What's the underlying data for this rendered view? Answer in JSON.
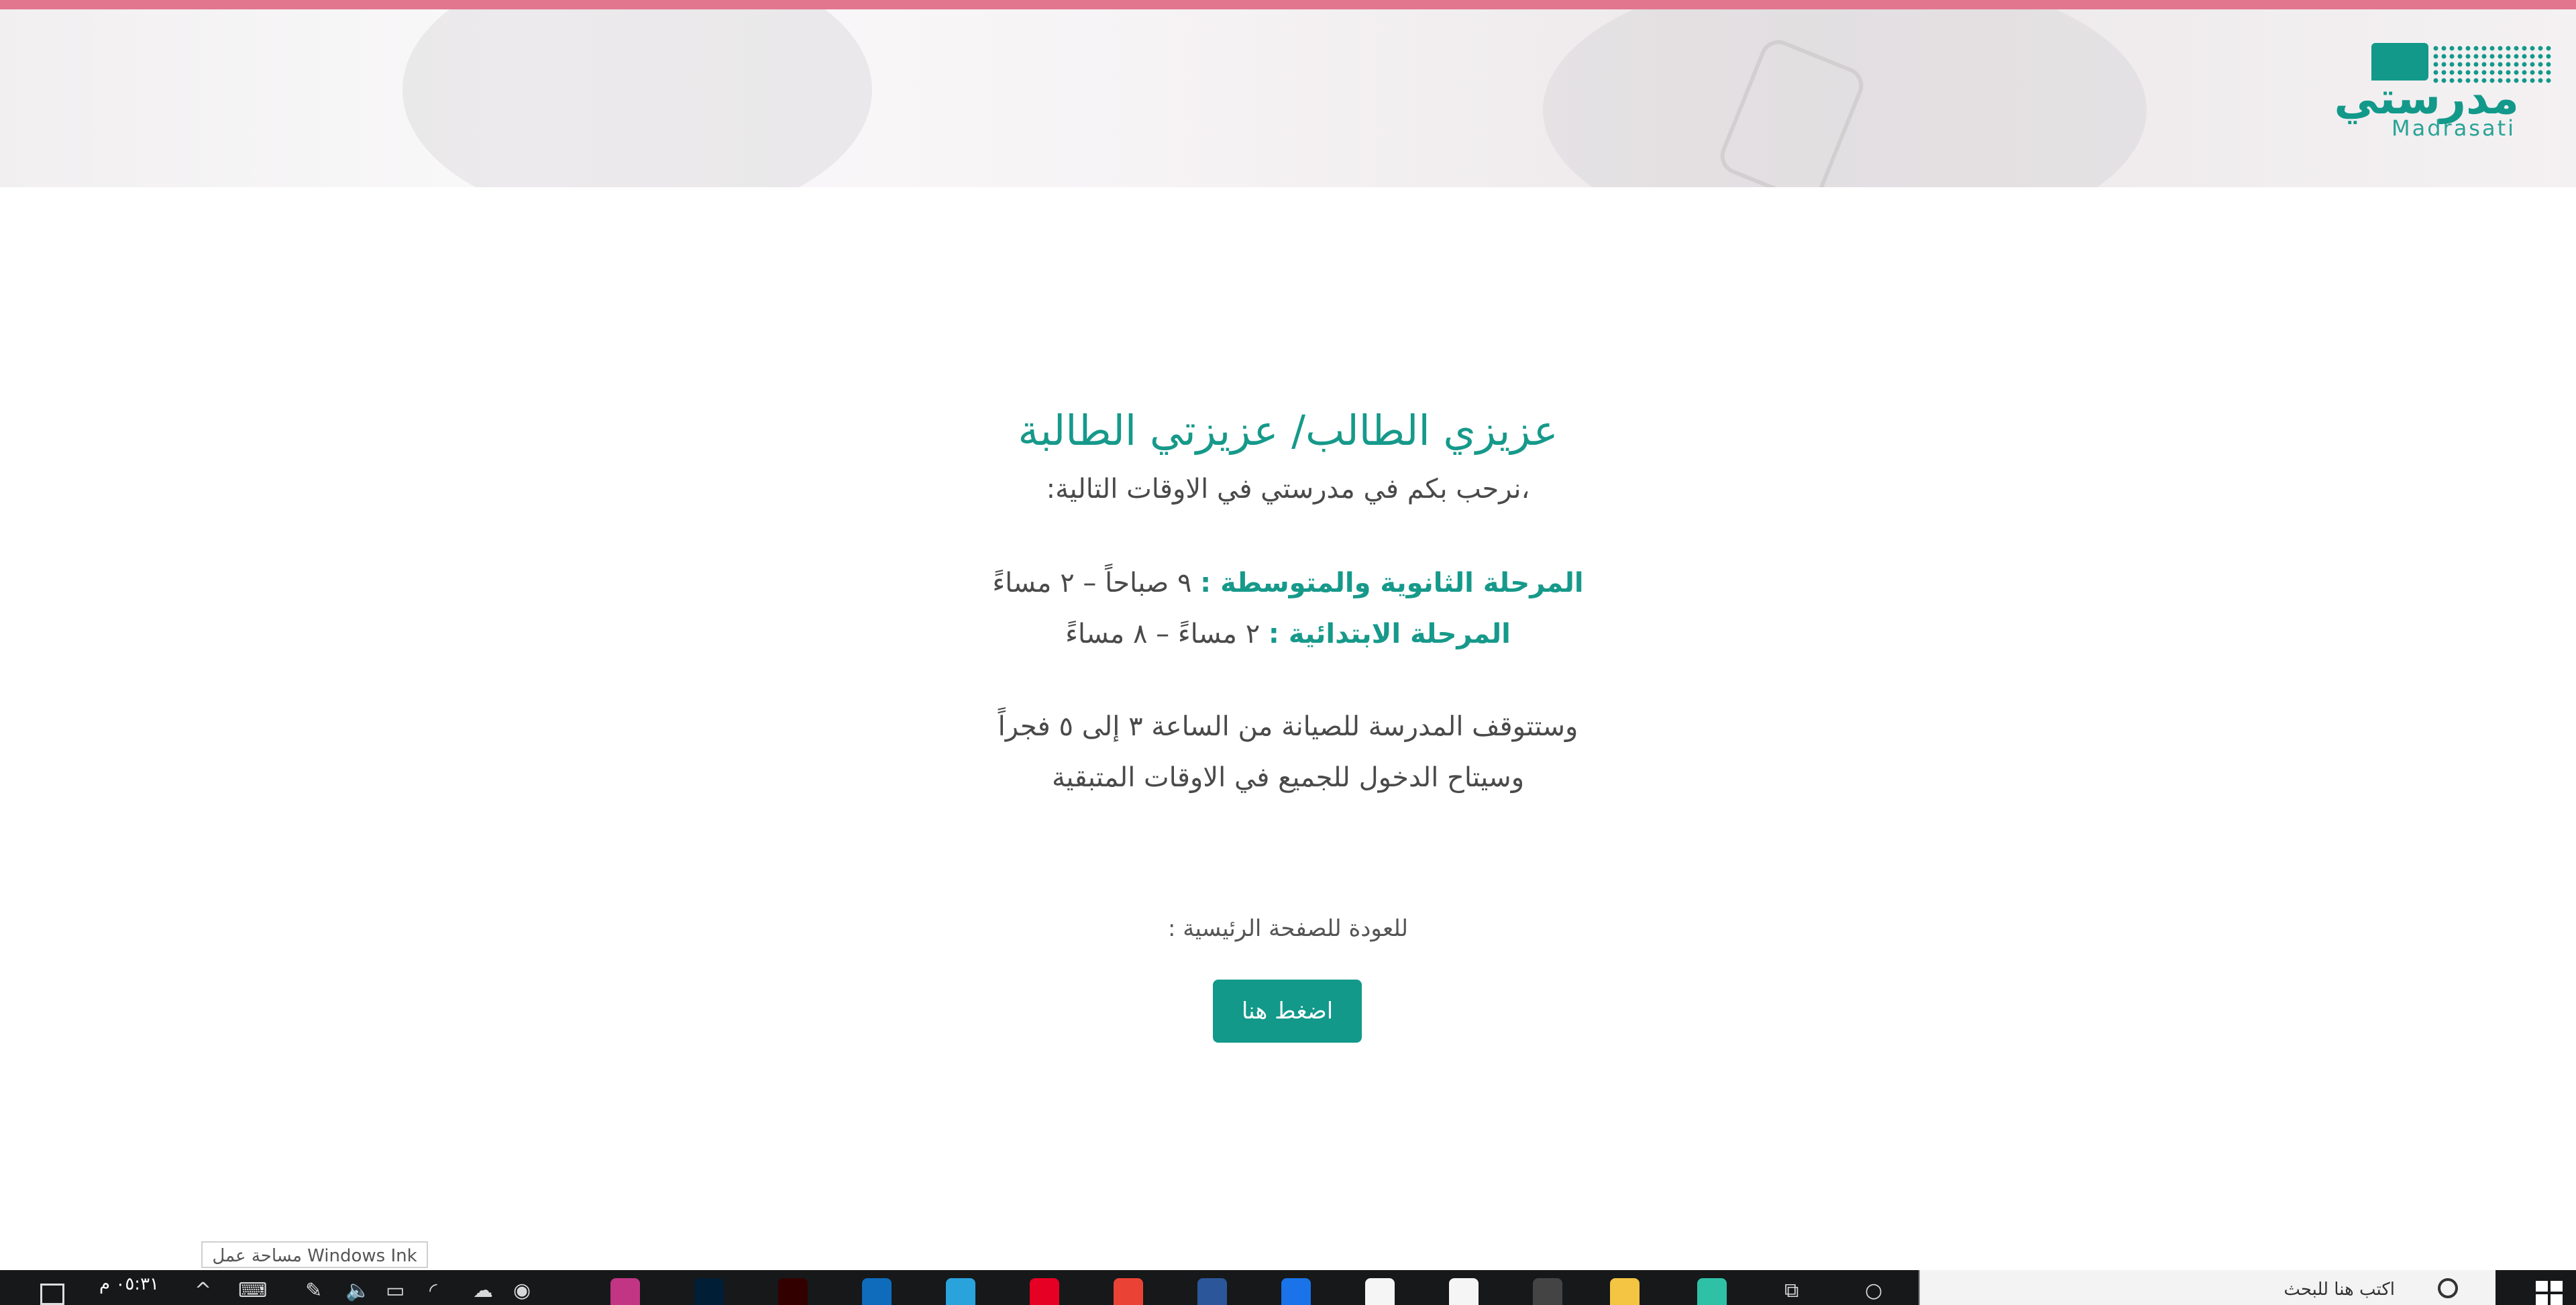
{
  "header": {
    "logo_arabic": "مدرستي",
    "logo_english": "Madrasati"
  },
  "main": {
    "title": "عزيزي الطالب/ عزيزتي الطالبة",
    "welcome": "،نرحب بكم في مدرستي في الاوقات التالية:",
    "schedule": [
      {
        "label": "المرحلة الثانوية والمتوسطة :",
        "time": " ٩ صباحاً – ٢ مساءً"
      },
      {
        "label": "المرحلة الابتدائية :",
        "time": " ٢ مساءً – ٨ مساءً"
      }
    ],
    "maintenance_line1": "وستتوقف المدرسة للصيانة من الساعة ٣ إلى ٥ فجراً",
    "maintenance_line2": "وسيتاح الدخول للجميع في الاوقات المتبقية",
    "back_label": "للعودة للصفحة الرئيسية :",
    "button_label": "اضغط هنا"
  },
  "tooltip": {
    "text": "مساحة عمل Windows Ink"
  },
  "taskbar": {
    "clock": "٠٥:٣١ م",
    "search_placeholder": "اكتب هنا للبحث",
    "pinned_apps": [
      {
        "name": "instagram-icon",
        "color": "#c13584"
      },
      {
        "name": "photoshop-icon",
        "color": "#001e36"
      },
      {
        "name": "illustrator-icon",
        "color": "#330000"
      },
      {
        "name": "edge-app-icon",
        "color": "#0f6cbd"
      },
      {
        "name": "telegram-icon",
        "color": "#2aa3dd"
      },
      {
        "name": "pinterest-icon",
        "color": "#e60023"
      },
      {
        "name": "chrome-icon",
        "color": "#ea4335"
      },
      {
        "name": "word-icon",
        "color": "#2b579a"
      },
      {
        "name": "mail-icon",
        "color": "#1a73e8"
      },
      {
        "name": "dropbox-icon",
        "color": "#f5f5f5"
      },
      {
        "name": "store-icon",
        "color": "#f5f5f5"
      },
      {
        "name": "amazon-icon",
        "color": "#444444"
      },
      {
        "name": "file-explorer-icon",
        "color": "#f4c542"
      },
      {
        "name": "edge-icon",
        "color": "#2ec1a5"
      }
    ]
  }
}
